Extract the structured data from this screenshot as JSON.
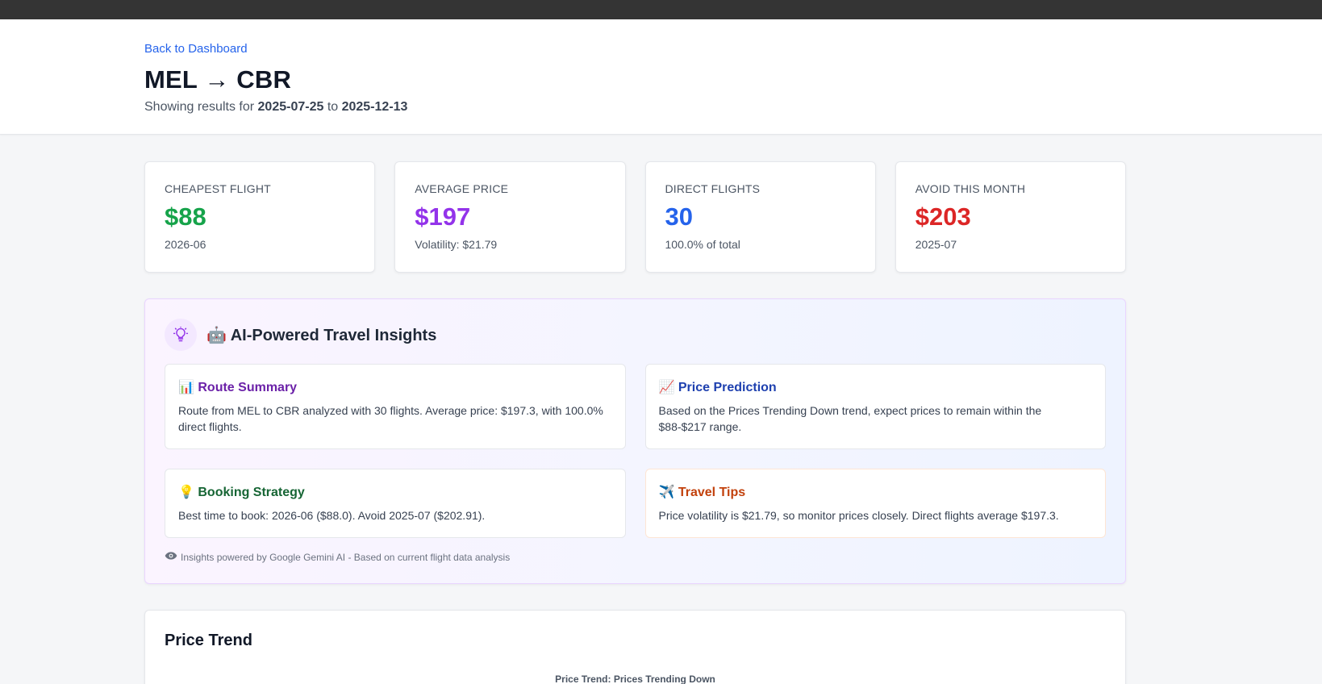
{
  "header": {
    "back_link": "Back to Dashboard",
    "route_title": "MEL → CBR",
    "subtitle_prefix": "Showing results for",
    "date_from": "2025-07-25",
    "subtitle_mid": "to",
    "date_to": "2025-12-13"
  },
  "stats": [
    {
      "label": "CHEAPEST FLIGHT",
      "value": "$88",
      "sub": "2026-06",
      "color": "#16a34a"
    },
    {
      "label": "AVERAGE PRICE",
      "value": "$197",
      "sub": "Volatility: $21.79",
      "color": "#9333ea"
    },
    {
      "label": "DIRECT FLIGHTS",
      "value": "30",
      "sub": "100.0% of total",
      "color": "#2563eb"
    },
    {
      "label": "AVOID THIS MONTH",
      "value": "$203",
      "sub": "2025-07",
      "color": "#dc2626"
    }
  ],
  "insights": {
    "title": "🤖 AI-Powered Travel Insights",
    "cards": [
      {
        "title": "📊 Route Summary",
        "text": "Route from MEL to CBR analyzed with 30 flights. Average price: $197.3, with 100.0% direct flights.",
        "color": "#6b21a8"
      },
      {
        "title": "📈 Price Prediction",
        "text": "Based on the Prices Trending Down trend, expect prices to remain within the $88-$217 range.",
        "color": "#1e40af"
      },
      {
        "title": "💡 Booking Strategy",
        "text": "Best time to book: 2026-06 ($88.0). Avoid 2025-07 ($202.91).",
        "color": "#166534"
      },
      {
        "title": "✈️ Travel Tips",
        "text": "Price volatility is $21.79, so monitor prices closely. Direct flights average $197.3.",
        "color": "#c2410c"
      }
    ],
    "footnote": "Insights powered by Google Gemini AI - Based on current flight data analysis"
  },
  "price_trend": {
    "title": "Price Trend",
    "chart_title": "Price Trend: Prices Trending Down"
  }
}
